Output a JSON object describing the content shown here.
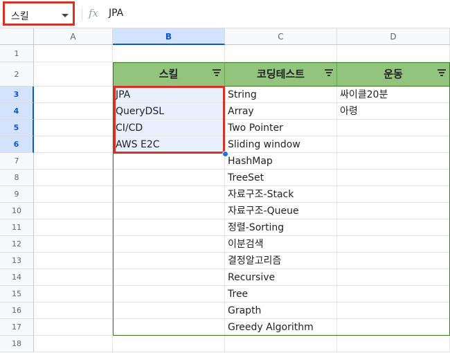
{
  "formula_bar": {
    "name_box": "스킬",
    "fx_label": "fx",
    "formula": "JPA"
  },
  "columns": [
    "A",
    "B",
    "C",
    "D"
  ],
  "rows": [
    "1",
    "2",
    "3",
    "4",
    "5",
    "6",
    "7",
    "8",
    "9",
    "10",
    "11",
    "12",
    "13",
    "14",
    "15",
    "16",
    "17",
    "18"
  ],
  "table": {
    "headers": [
      "스킬",
      "코딩테스트",
      "운동"
    ],
    "skill": [
      "JPA",
      "QueryDSL",
      "CI/CD",
      "AWS E2C"
    ],
    "coding_test": [
      "String",
      "Array",
      "Two Pointer",
      "Sliding window",
      "HashMap",
      "TreeSet",
      "자료구조-Stack",
      "자료구조-Queue",
      "정렬-Sorting",
      "이분검색",
      "결정알고리즘",
      "Recursive",
      "Tree",
      "Grapth",
      "Greedy Algorithm"
    ],
    "exercise": [
      "싸이클20분",
      "아령"
    ]
  },
  "colors": {
    "header_fill": "#93c47d",
    "highlight": "#d93025",
    "selection": "#0b57d0"
  }
}
